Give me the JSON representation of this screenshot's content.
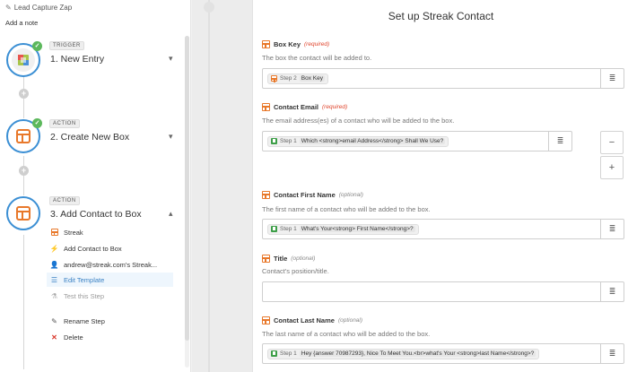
{
  "zap": {
    "title": "Lead Capture Zap",
    "add_note": "Add a note"
  },
  "steps": [
    {
      "tag": "TRIGGER",
      "title": "1. New Entry"
    },
    {
      "tag": "ACTION",
      "title": "2. Create New Box"
    },
    {
      "tag": "ACTION",
      "title": "3. Add Contact to Box"
    }
  ],
  "step3_menu": [
    {
      "label": "Streak",
      "icon": "streak-icon"
    },
    {
      "label": "Add Contact to Box",
      "icon": "bolt-icon"
    },
    {
      "label": "andrew@streak.com's Streak...",
      "icon": "user-icon"
    },
    {
      "label": "Edit Template",
      "icon": "list-icon",
      "state": "active"
    },
    {
      "label": "Test this Step",
      "icon": "flask-icon",
      "state": "muted"
    },
    {
      "label": "Rename Step",
      "icon": "pencil-icon"
    },
    {
      "label": "Delete",
      "icon": "x-icon"
    }
  ],
  "panel": {
    "title": "Set up Streak Contact",
    "fields": [
      {
        "label": "Box Key",
        "badge": "(required)",
        "help": "The box the contact will be added to.",
        "step": "Step 2",
        "value": "Box Key"
      },
      {
        "label": "Contact Email",
        "badge": "(required)",
        "help": "The email address(es) of a contact who will be added to the box.",
        "step": "Step 1",
        "value": "Which <strong>email Address</strong> Shall We Use?"
      },
      {
        "label": "Contact First Name",
        "badge": "(optional)",
        "help": "The first name of a contact who will be added to the box.",
        "step": "Step 1",
        "value": "What's Your<strong> First Name</strong>?"
      },
      {
        "label": "Title",
        "badge": "(optional)",
        "help": "Contact's position/title.",
        "step": "",
        "value": ""
      },
      {
        "label": "Contact Last Name",
        "badge": "(optional)",
        "help": "The last name of a contact who will be added to the box.",
        "step": "Step 1",
        "value": "Hey {answer 70987293}, Nice To Meet You.<br>what's Your <strong>last Name</strong>?"
      }
    ],
    "remove_button": "−",
    "add_button": "+"
  },
  "colors": {
    "accent": "#3b8fd4",
    "streak": "#e8782a",
    "success": "#5cb85c",
    "danger": "#d9372b",
    "required": "#e0462e"
  }
}
